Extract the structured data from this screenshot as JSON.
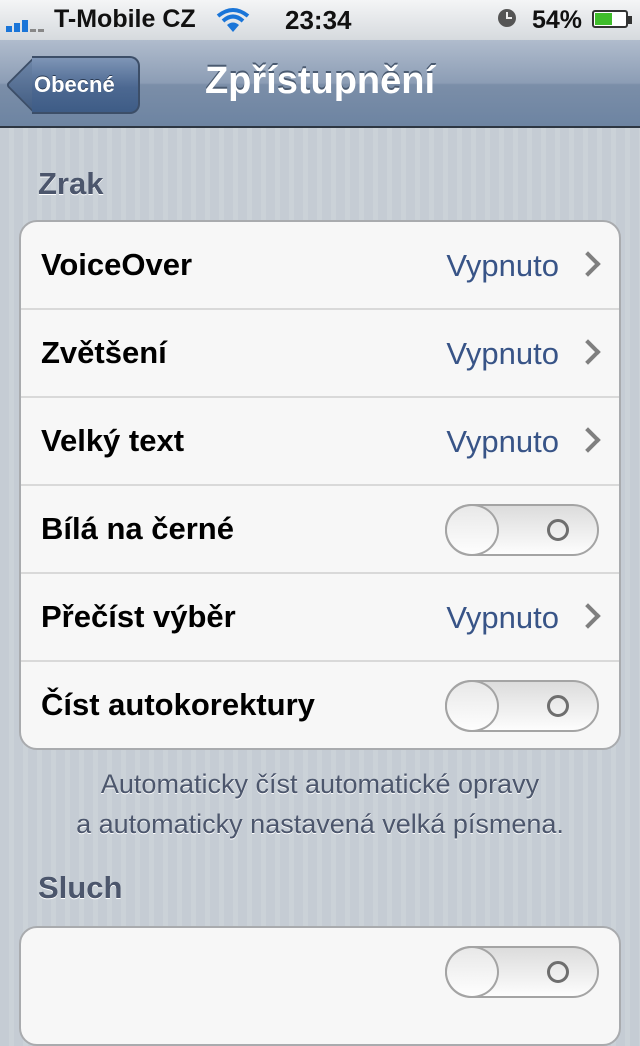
{
  "status_bar": {
    "carrier": "T-Mobile CZ",
    "time": "23:34",
    "battery": "54%",
    "battery_level": 0.54
  },
  "nav": {
    "back_label": "Obecné",
    "title": "Zpřístupnění"
  },
  "sections": {
    "vision": {
      "header": "Zrak",
      "rows": [
        {
          "label": "VoiceOver",
          "value": "Vypnuto"
        },
        {
          "label": "Zvětšení",
          "value": "Vypnuto"
        },
        {
          "label": "Velký text",
          "value": "Vypnuto"
        },
        {
          "label": "Bílá na černé",
          "toggle": false
        },
        {
          "label": "Přečíst výběr",
          "value": "Vypnuto"
        },
        {
          "label": "Číst autokorektury",
          "toggle": false
        }
      ],
      "footer_line1": "Automaticky číst automatické opravy",
      "footer_line2": "a automaticky nastavená velká písmena."
    },
    "hearing": {
      "header": "Sluch"
    }
  },
  "icons": [
    "signal-icon",
    "wifi-icon",
    "alarm-clock-icon",
    "battery-icon",
    "chevron-right-icon"
  ]
}
